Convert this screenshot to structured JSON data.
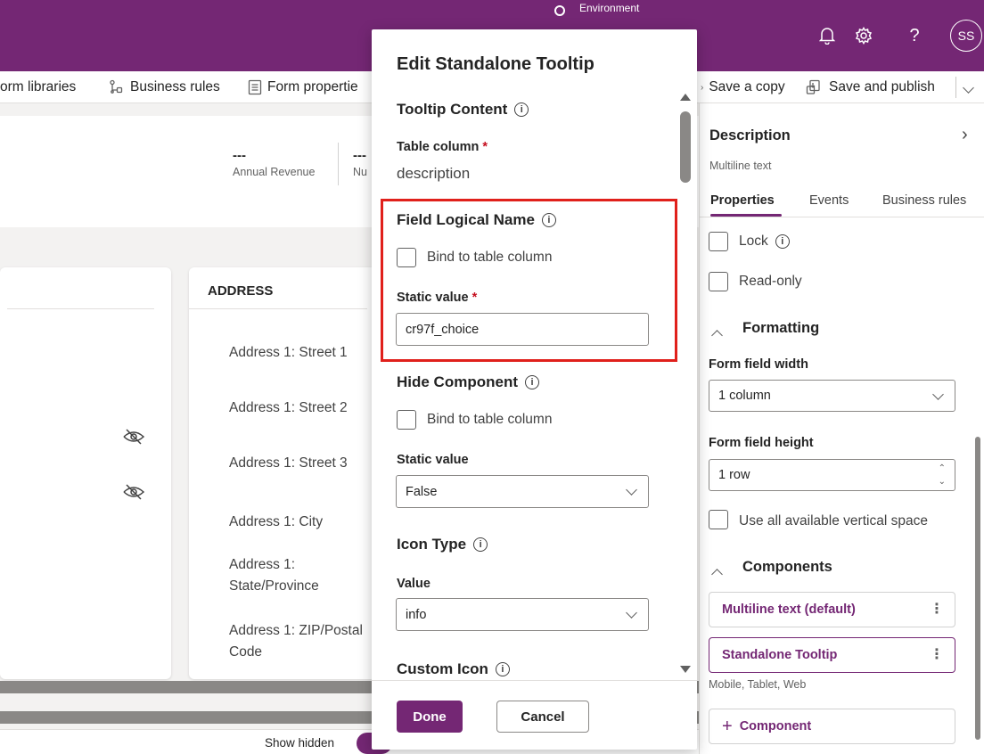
{
  "topbar": {
    "environment_label": "Environment",
    "user_initials": "SS",
    "icons": [
      "bell-icon",
      "gear-icon",
      "help-icon"
    ]
  },
  "command_bar": {
    "form_libraries": "orm libraries",
    "business_rules": "Business rules",
    "form_properties": "Form propertie",
    "save_copy": "Save a copy",
    "save_publish": "Save and publish"
  },
  "canvas": {
    "header_fields": [
      {
        "value": "---",
        "label": "Annual Revenue"
      },
      {
        "value": "---",
        "label": "Nu"
      }
    ],
    "address": {
      "title": "ADDRESS",
      "fields": [
        "Address 1: Street 1",
        "Address 1: Street 2",
        "Address 1: Street 3",
        "Address 1: City",
        "Address 1: State/Province",
        "Address 1: ZIP/Postal Code"
      ]
    },
    "show_hidden_label": "Show hidden"
  },
  "modal": {
    "title": "Edit Standalone Tooltip",
    "tooltip_content": {
      "section": "Tooltip Content",
      "table_column_label": "Table column",
      "table_column_value": "description"
    },
    "field_logical_name": {
      "section": "Field Logical Name",
      "bind_label": "Bind to table column",
      "bind_checked": false,
      "static_label": "Static value",
      "static_value": "cr97f_choice"
    },
    "hide_component": {
      "section": "Hide Component",
      "bind_label": "Bind to table column",
      "bind_checked": false,
      "static_label": "Static value",
      "static_value": "False"
    },
    "icon_type": {
      "section": "Icon Type",
      "value_label": "Value",
      "value": "info"
    },
    "custom_icon": {
      "section": "Custom Icon"
    },
    "done_label": "Done",
    "cancel_label": "Cancel"
  },
  "properties_pane": {
    "title": "Description",
    "subtitle": "Multiline text",
    "tabs": [
      "Properties",
      "Events",
      "Business rules"
    ],
    "active_tab": "Properties",
    "lock_label": "Lock",
    "readonly_label": "Read-only",
    "formatting": {
      "section": "Formatting",
      "width_label": "Form field width",
      "width_value": "1 column",
      "height_label": "Form field height",
      "height_value": "1 row",
      "vertical_space_label": "Use all available vertical space"
    },
    "components": {
      "section": "Components",
      "items": [
        {
          "label": "Multiline text (default)",
          "selected": false
        },
        {
          "label": "Standalone Tooltip",
          "selected": true
        }
      ],
      "selected_note": "Mobile, Tablet, Web",
      "add_label": "Component"
    }
  },
  "colors": {
    "brand": "#742774",
    "highlight": "#e0201b",
    "required": "#c50f1f"
  }
}
